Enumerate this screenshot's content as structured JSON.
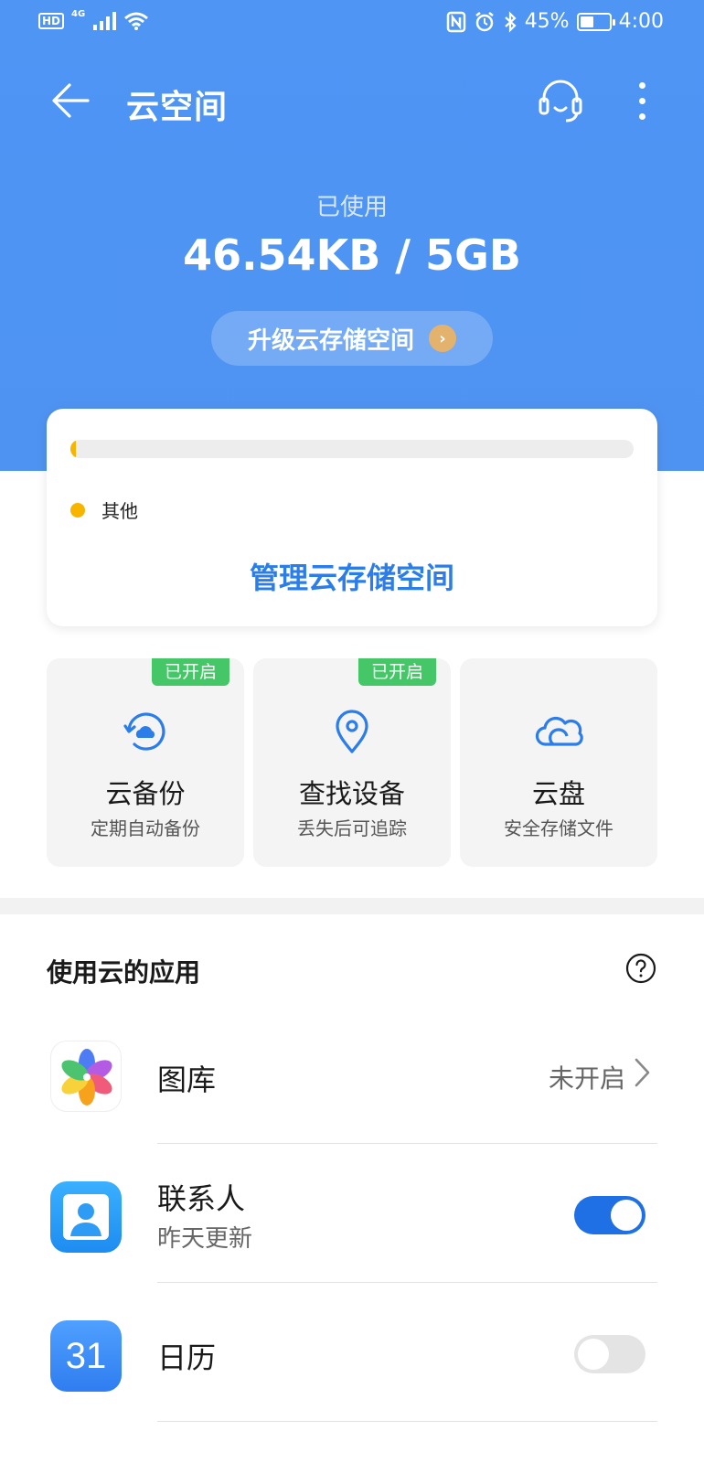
{
  "status_bar": {
    "hd": "HD",
    "network": "4G",
    "battery": "45%",
    "battery_level": 0.45,
    "time": "4:00"
  },
  "toolbar": {
    "title": "云空间"
  },
  "usage": {
    "label": "已使用",
    "value": "46.54KB / 5GB",
    "used_fraction": 1e-05
  },
  "upgrade_button": {
    "label": "升级云存储空间"
  },
  "storage_card": {
    "legend": [
      {
        "label": "其他",
        "color": "#f7b500"
      }
    ],
    "manage_label": "管理云存储空间"
  },
  "features": [
    {
      "title": "云备份",
      "subtitle": "定期自动备份",
      "badge": "已开启",
      "icon": "backup-icon"
    },
    {
      "title": "查找设备",
      "subtitle": "丢失后可追踪",
      "badge": "已开启",
      "icon": "location-pin-icon"
    },
    {
      "title": "云盘",
      "subtitle": "安全存储文件",
      "badge": "",
      "icon": "cloud-icon"
    }
  ],
  "apps_section": {
    "title": "使用云的应用"
  },
  "apps": [
    {
      "name": "图库",
      "status": "未开启",
      "icon": "gallery-icon"
    },
    {
      "name": "联系人",
      "subtitle": "昨天更新",
      "enabled": true,
      "icon": "contacts-icon"
    },
    {
      "name": "日历",
      "icon_text": "31",
      "enabled": false,
      "icon": "calendar-icon"
    }
  ],
  "colors": {
    "hero_blue": "#4f93f2",
    "accent_blue": "#2b7de9",
    "badge_green": "#45c767",
    "legend_yellow": "#f7b500",
    "toggle_on": "#1f6fe5"
  }
}
